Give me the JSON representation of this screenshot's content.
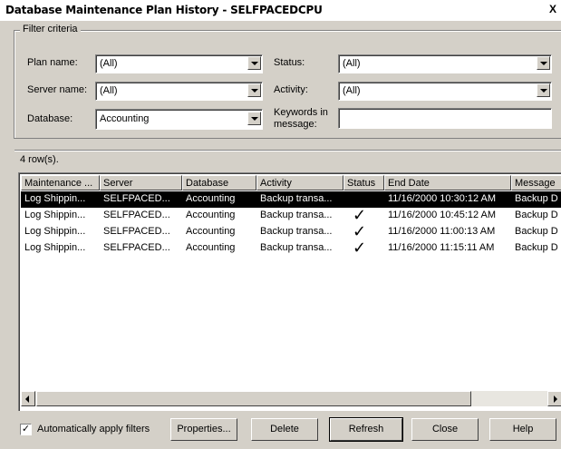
{
  "window": {
    "title": "Database Maintenance Plan History - SELFPACEDCPU",
    "close_glyph": "X"
  },
  "filter": {
    "legend": "Filter criteria",
    "plan_name": {
      "label": "Plan name:",
      "value": "(All)"
    },
    "server_name": {
      "label": "Server name:",
      "value": "(All)"
    },
    "database": {
      "label": "Database:",
      "value": "Accounting"
    },
    "status": {
      "label": "Status:",
      "value": "(All)"
    },
    "activity": {
      "label": "Activity:",
      "value": "(All)"
    },
    "keywords": {
      "label_line1": "Keywords in",
      "label_line2": "message:",
      "value": ""
    }
  },
  "row_count": "4 row(s).",
  "table": {
    "columns": [
      "Maintenance ...",
      "Server",
      "Database",
      "Activity",
      "Status",
      "End Date",
      "Message"
    ],
    "rows": [
      {
        "plan": "Log Shippin...",
        "server": "SELFPACED...",
        "database": "Accounting",
        "activity": "Backup transa...",
        "status": "",
        "end_date": "11/16/2000 10:30:12 AM",
        "message": "Backup D",
        "selected": true
      },
      {
        "plan": "Log Shippin...",
        "server": "SELFPACED...",
        "database": "Accounting",
        "activity": "Backup transa...",
        "status": "✓",
        "end_date": "11/16/2000 10:45:12 AM",
        "message": "Backup D",
        "selected": false
      },
      {
        "plan": "Log Shippin...",
        "server": "SELFPACED...",
        "database": "Accounting",
        "activity": "Backup transa...",
        "status": "✓",
        "end_date": "11/16/2000 11:00:13 AM",
        "message": "Backup D",
        "selected": false
      },
      {
        "plan": "Log Shippin...",
        "server": "SELFPACED...",
        "database": "Accounting",
        "activity": "Backup transa...",
        "status": "✓",
        "end_date": "11/16/2000 11:15:11 AM",
        "message": "Backup D",
        "selected": false
      }
    ]
  },
  "footer": {
    "auto_apply": {
      "label": "Automatically apply filters",
      "checked": true,
      "check_glyph": "✓"
    },
    "buttons": {
      "properties": "Properties...",
      "delete": "Delete",
      "refresh": "Refresh",
      "close": "Close",
      "help": "Help"
    }
  }
}
